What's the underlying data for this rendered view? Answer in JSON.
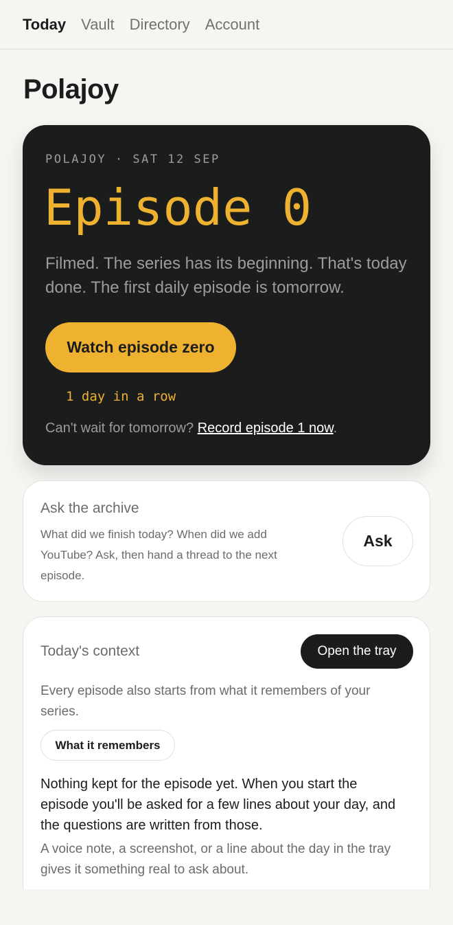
{
  "nav": {
    "items": [
      "Today",
      "Vault",
      "Directory",
      "Account"
    ],
    "active": "Today"
  },
  "page": {
    "title": "Polajoy"
  },
  "hero": {
    "meta": "POLAJOY · SAT 12 SEP",
    "episode": "Episode 0",
    "description": "Filmed. The series has its beginning. That's today done. The first daily episode is tomorrow.",
    "watch_label": "Watch episode zero",
    "streak": "1 day in a row",
    "footer_text": "Can't wait for tomorrow?",
    "footer_link": "Record episode 1 now",
    "footer_end": "."
  },
  "ask_card": {
    "title": "Ask the archive",
    "body": "What did we finish today? When did we add YouTube? Ask, then hand a thread to the next episode.",
    "button": "Ask"
  },
  "context_card": {
    "title": "Today's context",
    "tray_button": "Open the tray",
    "intro": "Every episode also starts from what it remembers of your series.",
    "remembers_button": "What it remembers",
    "empty_state": "Nothing kept for the episode yet. When you start the episode you'll be asked for a few lines about your day, and the questions are written from those.",
    "hint": "A voice note, a screenshot, or a line about the day in the tray gives it something real to ask about."
  },
  "colors": {
    "accent": "#efb130",
    "dark": "#1b1c1c",
    "background": "#f5f5f2"
  }
}
